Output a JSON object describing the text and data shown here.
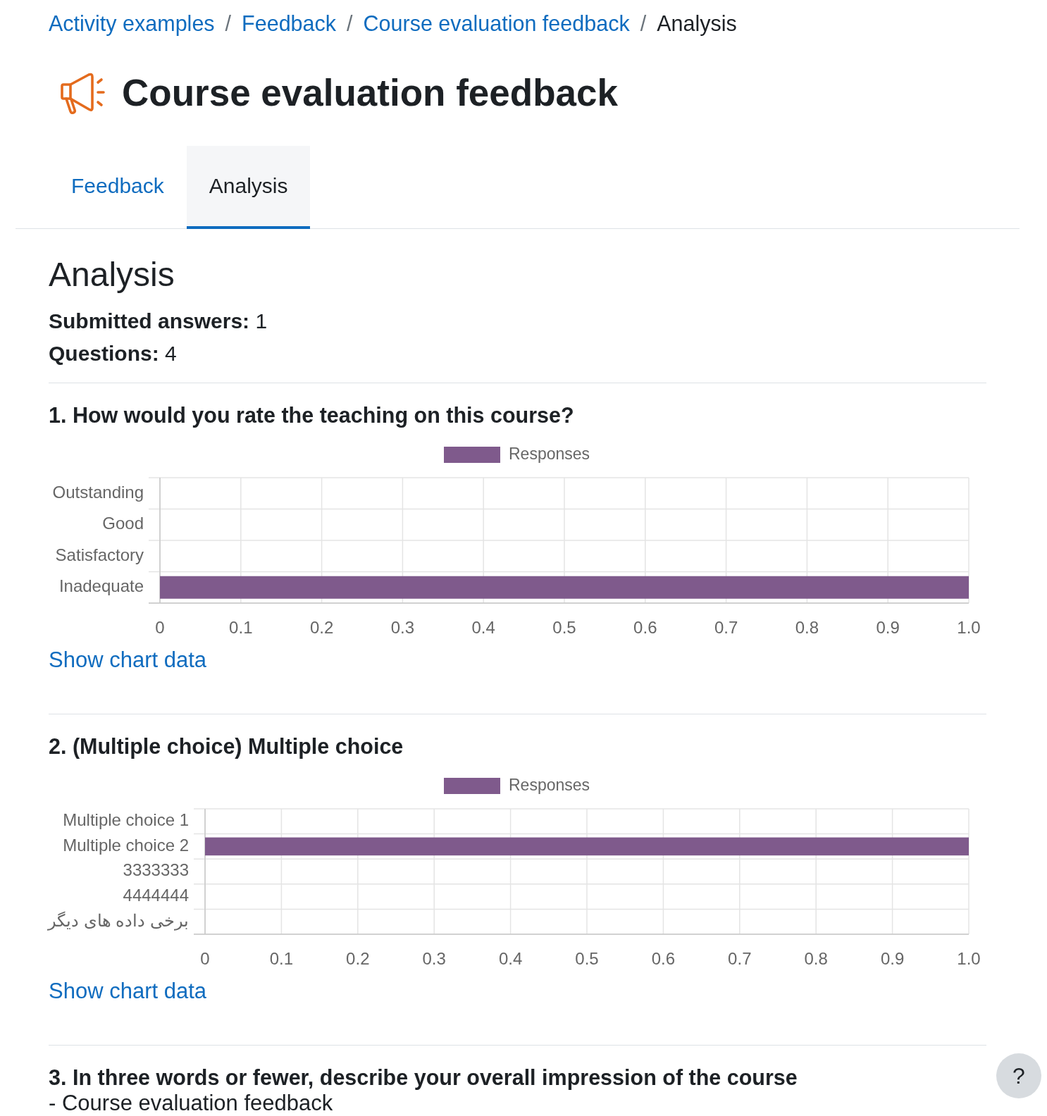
{
  "breadcrumb": [
    {
      "label": "Activity examples",
      "current": false
    },
    {
      "separator": "/",
      "label": "Feedback",
      "current": false
    },
    {
      "separator": "/",
      "label": "Course evaluation feedback",
      "current": false
    },
    {
      "separator": "/",
      "label": "Analysis",
      "current": true
    }
  ],
  "page_title": "Course evaluation feedback",
  "tabs": [
    {
      "label": "Feedback",
      "selected": false
    },
    {
      "label": "Analysis",
      "selected": true
    }
  ],
  "heading": "Analysis",
  "summary": [
    "**Submitted answers:** 1",
    "**Questions:** 4"
  ],
  "questions": [
    {
      "kind": "chart",
      "title": "1. How would you rate the teaching on this course?",
      "chart_data": {
        "type": "bar",
        "orientation": "horizontal",
        "grid": true,
        "categories": [
          "Outstanding",
          "Good",
          "Satisfactory",
          "Inadequate"
        ],
        "series": [
          {
            "name": "Responses",
            "color": "#7f5a8c",
            "values": [
              0,
              0,
              0,
              1
            ]
          }
        ],
        "xlim": [
          0,
          1
        ],
        "xticks": [
          0,
          0.1,
          0.2,
          0.3,
          0.4,
          0.5,
          0.6,
          0.7,
          0.8,
          0.9,
          {
            "value": 1,
            "label": "1.0"
          }
        ]
      },
      "link": "Show chart data"
    },
    {
      "kind": "chart",
      "title": "2. (Multiple choice) Multiple choice",
      "chart_data": {
        "type": "bar",
        "orientation": "horizontal",
        "grid": true,
        "categories": [
          "Multiple choice 1",
          "Multiple choice 2",
          "3333333",
          "4444444",
          "برخی داده های دیگر"
        ],
        "series": [
          {
            "name": "Responses",
            "color": "#7f5a8c",
            "values": [
              0,
              1,
              0,
              0,
              0
            ]
          }
        ],
        "xlim": [
          0,
          1
        ],
        "xticks": [
          0,
          0.1,
          0.2,
          0.3,
          0.4,
          0.5,
          0.6,
          0.7,
          0.8,
          0.9,
          {
            "value": 1,
            "label": "1.0"
          }
        ]
      },
      "link": "Show chart data"
    },
    {
      "kind": "text",
      "title": "3. In three words or fewer, describe your overall impression of the course",
      "answers": [
        "- Course evaluation feedback"
      ]
    }
  ],
  "help_button": {
    "label": "?"
  }
}
